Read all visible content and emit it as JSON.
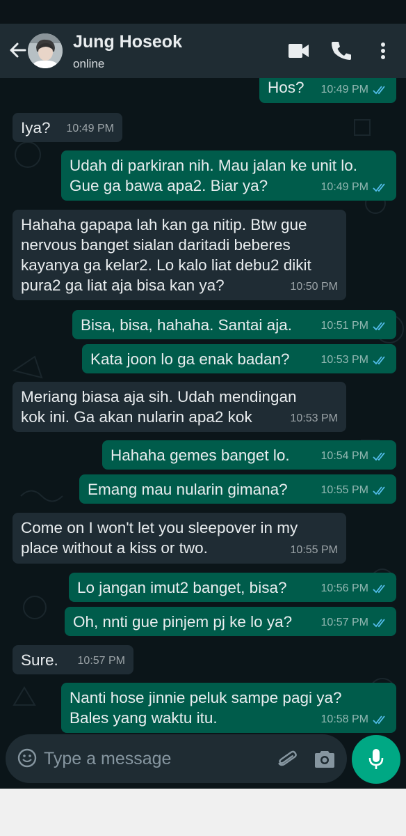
{
  "header": {
    "contact_name": "Jung Hoseok",
    "status": "online"
  },
  "messages": [
    {
      "direction": "out",
      "text": "Hos?",
      "time": "10:49 PM",
      "read": true
    },
    {
      "direction": "in",
      "text": "Iya?",
      "time": "10:49 PM"
    },
    {
      "direction": "out",
      "text": "Udah di parkiran nih. Mau jalan ke unit lo.\nGue ga bawa apa2. Biar ya?",
      "time": "10:49 PM",
      "read": true
    },
    {
      "direction": "in",
      "text": "Hahaha gapapa lah kan ga nitip. Btw gue\nnervous banget sialan daritadi beberes\nkayanya ga kelar2. Lo kalo liat debu2 dikit\npura2 ga liat aja bisa kan ya?",
      "time": "10:50 PM"
    },
    {
      "direction": "out",
      "text": "Bisa, bisa, hahaha. Santai aja.",
      "time": "10:51 PM",
      "read": true
    },
    {
      "direction": "out",
      "text": "Kata joon lo ga enak badan?",
      "time": "10:53 PM",
      "read": true
    },
    {
      "direction": "in",
      "text": "Meriang biasa aja sih. Udah mendingan\nkok ini. Ga akan nularin apa2 kok",
      "time": "10:53 PM"
    },
    {
      "direction": "out",
      "text": "Hahaha gemes banget lo.",
      "time": "10:54 PM",
      "read": true
    },
    {
      "direction": "out",
      "text": "Emang mau nularin gimana?",
      "time": "10:55 PM",
      "read": true
    },
    {
      "direction": "in",
      "text": "Come on I won't let you sleepover in my\nplace without a kiss or two.",
      "time": "10:55 PM"
    },
    {
      "direction": "out",
      "text": "Lo jangan imut2 banget, bisa?",
      "time": "10:56 PM",
      "read": true
    },
    {
      "direction": "out",
      "text": "Oh, nnti gue pinjem pj ke lo ya?",
      "time": "10:57 PM",
      "read": true
    },
    {
      "direction": "in",
      "text": "Sure.",
      "time": "10:57 PM"
    },
    {
      "direction": "out",
      "text": "Nanti hose jinnie peluk sampe pagi ya?\nBales yang waktu itu.",
      "time": "10:58 PM",
      "read": true
    }
  ],
  "composer": {
    "placeholder": "Type a message"
  },
  "icons": {
    "back": "arrow-left-icon",
    "video": "video-call-icon",
    "call": "phone-icon",
    "menu": "more-vert-icon",
    "emoji": "emoji-icon",
    "attach": "paperclip-icon",
    "camera": "camera-icon",
    "mic": "mic-icon",
    "read_receipt": "double-check-icon"
  },
  "colors": {
    "header_bg": "#1f2c33",
    "chat_bg": "#0b1519",
    "incoming_bubble": "#1f2c34",
    "outgoing_bubble": "#005c4b",
    "read_tick": "#53bdeb",
    "accent": "#00a884"
  }
}
